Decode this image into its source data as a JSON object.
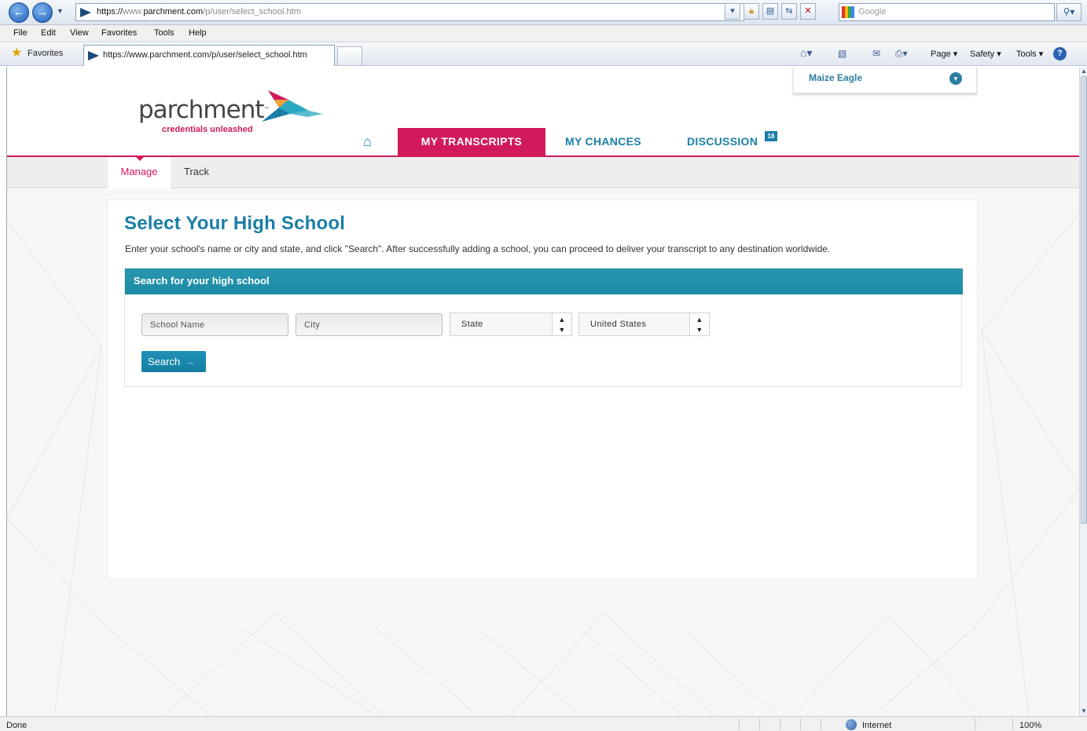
{
  "browser": {
    "url": {
      "scheme": "https://",
      "sub": "www.",
      "host": "parchment.com",
      "path": "/p/user/select_school.htm"
    },
    "search_placeholder": "Google",
    "menu": [
      "File",
      "Edit",
      "View",
      "Favorites",
      "Tools",
      "Help"
    ],
    "favorites_label": "Favorites",
    "tab_title": "https://www.parchment.com/p/user/select_school.htm",
    "commands": {
      "page": "Page ▾",
      "safety": "Safety ▾",
      "tools": "Tools ▾"
    },
    "status": "Done",
    "zone": "Internet",
    "zoom": "100%"
  },
  "site": {
    "logo_word": "parchment",
    "logo_tm": "™",
    "tagline": "credentials unleashed",
    "user_name": "Maize Eagle",
    "nav": {
      "transcripts": "MY TRANSCRIPTS",
      "chances": "MY CHANCES",
      "discussion": "DISCUSSION",
      "discussion_badge": "18"
    },
    "subnav": {
      "manage": "Manage",
      "track": "Track"
    }
  },
  "main": {
    "title": "Select Your High School",
    "description": "Enter your school's name or city and state, and click \"Search\". After successfully adding a school, you can proceed to deliver your transcript to any destination worldwide.",
    "panel_title": "Search for your high school",
    "school_placeholder": "School Name",
    "city_placeholder": "City",
    "state_value": "State",
    "country_value": "United States",
    "search_label": "Search"
  },
  "colors": {
    "brand_pink": "#d1195c",
    "brand_teal": "#1a7ea7"
  },
  "icons": [
    "back-arrow-icon",
    "forward-arrow-icon",
    "lock-icon",
    "refresh-icon",
    "stop-icon",
    "favorites-star-icon",
    "home-icon",
    "feed-icon",
    "mail-icon",
    "print-icon",
    "help-icon",
    "internet-globe-icon",
    "zoom-icon"
  ]
}
